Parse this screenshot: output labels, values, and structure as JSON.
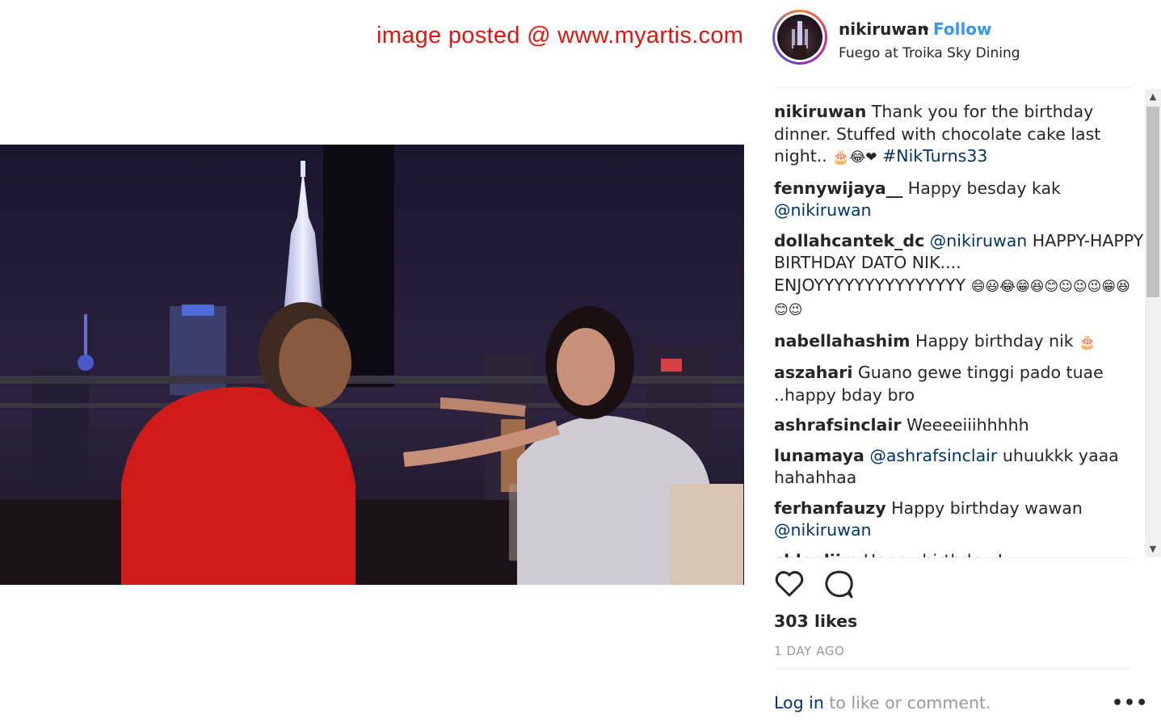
{
  "watermark": "image posted @ www.myartis.com",
  "post": {
    "username": "nikiruwan",
    "separator": "•",
    "follow_label": "Follow",
    "location": "Fuego at Troika Sky Dining"
  },
  "comments": [
    {
      "user": "nikiruwan",
      "parts": [
        {
          "t": "text",
          "v": "Thank you for the birthday dinner. Stuffed with chocolate cake last night.. "
        },
        {
          "t": "emoji",
          "v": "🎂😂❤"
        },
        {
          "t": "text",
          "v": " "
        },
        {
          "t": "hashtag",
          "v": "#NikTurns33"
        }
      ]
    },
    {
      "user": "fennywijaya__",
      "parts": [
        {
          "t": "text",
          "v": "Happy besday kak "
        },
        {
          "t": "mention",
          "v": "@nikiruwan"
        }
      ]
    },
    {
      "user": "dollahcantek_dc",
      "parts": [
        {
          "t": "mention",
          "v": "@nikiruwan"
        },
        {
          "t": "text",
          "v": " HAPPY-HAPPY BIRTHDAY DATO NIK.... ENJOYYYYYYYYYYYYYYY "
        },
        {
          "t": "emoji",
          "v": "😄😃😂😁😆😊☺😉😉😁😆😊😉"
        }
      ]
    },
    {
      "user": "nabellahashim",
      "parts": [
        {
          "t": "text",
          "v": "Happy birthday nik "
        },
        {
          "t": "emoji",
          "v": "🎂"
        }
      ]
    },
    {
      "user": "aszahari",
      "parts": [
        {
          "t": "text",
          "v": "Guano gewe tinggi pado tuae ..happy bday bro"
        }
      ]
    },
    {
      "user": "ashrafsinclair",
      "parts": [
        {
          "t": "text",
          "v": "Weeeeiiihhhhh"
        }
      ]
    },
    {
      "user": "lunamaya",
      "parts": [
        {
          "t": "mention",
          "v": "@ashrafsinclair"
        },
        {
          "t": "text",
          "v": " uhuukkk yaaa hahahhaa"
        }
      ]
    },
    {
      "user": "ferhanfauzy",
      "parts": [
        {
          "t": "text",
          "v": "Happy birthday wawan "
        },
        {
          "t": "mention",
          "v": "@nikiruwan"
        }
      ]
    },
    {
      "user": "chloeliim",
      "parts": [
        {
          "t": "text",
          "v": "Happy birthday !"
        }
      ]
    }
  ],
  "likes": "303 likes",
  "time_ago": "1 DAY AGO",
  "login": {
    "link": "Log in",
    "rest": " to like or comment."
  },
  "more_label": "•••",
  "icons": {
    "like": "heart-icon",
    "comment": "comment-icon",
    "scroll_up": "▲",
    "scroll_down": "▼"
  },
  "colors": {
    "accent": "#3897f0",
    "link": "#003569",
    "watermark": "#e3140f",
    "muted": "#999999"
  }
}
